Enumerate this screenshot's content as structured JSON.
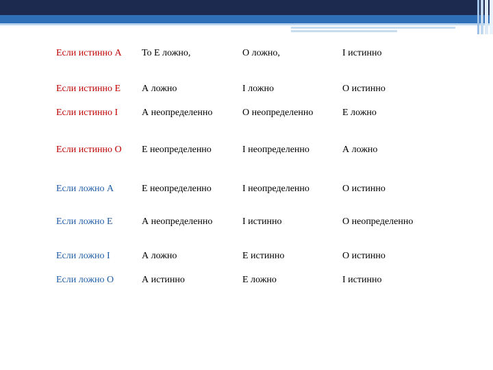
{
  "colors": {
    "header_dark": "#1d2a4f",
    "header_blue": "#2f6fb8",
    "true_label": "#c00000",
    "false_label": "#1f5ea8",
    "text": "#000000"
  },
  "rows": [
    {
      "cond": "Если  истинно А",
      "c1": "То Е ложно,",
      "c2": "О ложно,",
      "c3": "I истинно"
    },
    {
      "cond": "Если  истинно  Е",
      "c1": "А ложно",
      "c2": "I ложно",
      "c3": "О истинно"
    },
    {
      "cond": "Если истинно I",
      "c1": "А неопределенно",
      "c2": "О неопределенно",
      "c3": "Е ложно"
    },
    {
      "cond": "Если истинно О",
      "c1": "Е неопределенно",
      "c2": "I неопределенно",
      "c3": "А ложно"
    },
    {
      "cond": "Если ложно А",
      "c1": "Е неопределенно",
      "c2": "I неопределенно",
      "c3": "О истинно"
    },
    {
      "cond": "Если ложно  Е",
      "c1": "А неопределенно",
      "c2": "I истинно",
      "c3": "О неопределенно"
    },
    {
      "cond": "Если ложно  I",
      "c1": "А ложно",
      "c2": "Е истинно",
      "c3": "О истинно"
    },
    {
      "cond": "Если ложно  О",
      "c1": "А истинно",
      "c2": "Е ложно",
      "c3": "I истинно"
    }
  ]
}
